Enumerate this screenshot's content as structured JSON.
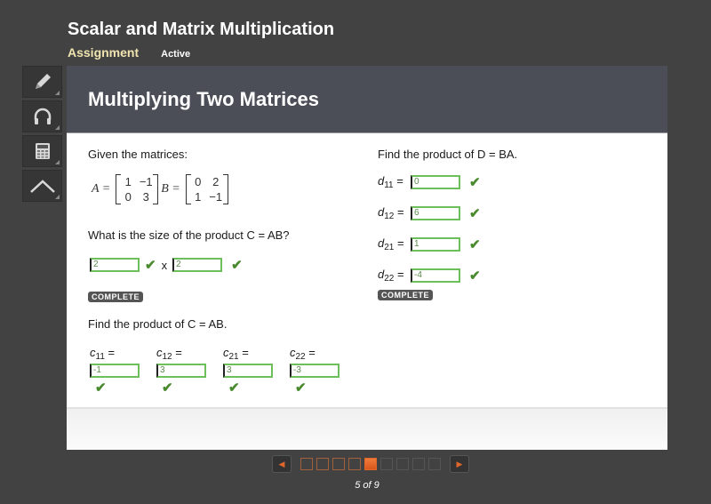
{
  "header": {
    "title": "Scalar and Matrix Multiplication",
    "type_label": "Assignment",
    "status": "Active"
  },
  "toolbar": {
    "tools": [
      {
        "name": "pencil-icon",
        "label": "Notes"
      },
      {
        "name": "headphones-icon",
        "label": "Audio"
      },
      {
        "name": "calculator-icon",
        "label": "Calculator"
      },
      {
        "name": "caret-up-icon",
        "label": "Reference"
      }
    ]
  },
  "panel": {
    "title": "Multiplying Two Matrices",
    "left": {
      "given_label": "Given the matrices:",
      "matrix_a": {
        "label": "A =",
        "values": [
          "1",
          "−1",
          "0",
          "3"
        ]
      },
      "matrix_b": {
        "label": "B =",
        "values": [
          "0",
          "2",
          "1",
          "−1"
        ]
      },
      "size_question": "What is the size of the product C = AB?",
      "size_answers": [
        "2",
        "2"
      ],
      "times_label": "x",
      "complete_badge": "COMPLETE",
      "product_label": "Find the product of C = AB.",
      "c_entries": [
        {
          "var": "c",
          "sub": "11",
          "value": "-1"
        },
        {
          "var": "c",
          "sub": "12",
          "value": "3"
        },
        {
          "var": "c",
          "sub": "21",
          "value": "3"
        },
        {
          "var": "c",
          "sub": "22",
          "value": "-3"
        }
      ]
    },
    "right": {
      "product_label": "Find the product of D = BA.",
      "d_entries": [
        {
          "var": "d",
          "sub": "11",
          "value": "0"
        },
        {
          "var": "d",
          "sub": "12",
          "value": "6"
        },
        {
          "var": "d",
          "sub": "21",
          "value": "1"
        },
        {
          "var": "d",
          "sub": "22",
          "value": "-4"
        }
      ],
      "complete_badge": "COMPLETE"
    },
    "check_glyph": "✔",
    "equals": "="
  },
  "pagination": {
    "current": 5,
    "total": 9,
    "label": "5 of 9",
    "prev_glyph": "◀",
    "next_glyph": "▶"
  },
  "colors": {
    "accent": "#e0662a",
    "correct": "#4a8a2e",
    "header_bg": "#4c4e57",
    "page_bg": "#424242"
  }
}
